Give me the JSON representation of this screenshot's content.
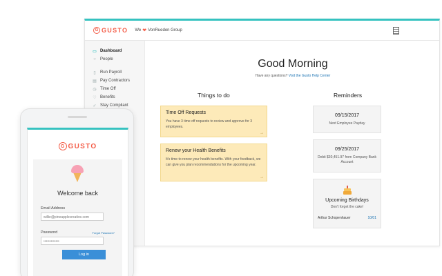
{
  "brand": {
    "logo_text": "GUSTO",
    "accent": "#35c2c0",
    "brand_color": "#f45d48"
  },
  "header": {
    "we_text": "We",
    "company": "VonRueden Group",
    "notes_icon": "document-icon"
  },
  "sidebar": {
    "items": [
      {
        "label": "Dashboard",
        "icon": "folder-icon",
        "active": true
      },
      {
        "label": "People",
        "icon": "person-icon"
      },
      {
        "label": "Run Payroll",
        "icon": "payroll-icon"
      },
      {
        "label": "Pay Contractors",
        "icon": "contractor-icon"
      },
      {
        "label": "Time Off",
        "icon": "clock-icon"
      },
      {
        "label": "Benefits",
        "icon": "heart-icon"
      },
      {
        "label": "Stay Compliant",
        "icon": "check-icon"
      }
    ]
  },
  "main": {
    "greeting": "Good Morning",
    "help_prefix": "Have any questions? ",
    "help_link": "Visit the Gusto Help Center",
    "todo_title": "Things to do",
    "reminders_title": "Reminders",
    "todos": [
      {
        "title": "Time Off Requests",
        "desc": "You have 3 time off requests to review and approve for 3 employees.",
        "arrow": "→"
      },
      {
        "title": "Renew your Health Benefits",
        "desc": "It's time to renew your health benefits. With your feedback, we can give you plan recommendations for the upcoming year.",
        "arrow": "→"
      }
    ],
    "reminders": [
      {
        "date": "09/15/2017",
        "sub": "Next Employee Payday"
      },
      {
        "date": "09/25/2017",
        "sub": "Debit $30,451.97 from Company Bank Account"
      }
    ],
    "birthday": {
      "title": "Upcoming Birthdays",
      "sub": "Don't forget the cake!",
      "name": "Arthur Schopenhauer",
      "date": "10/01"
    }
  },
  "mobile": {
    "welcome": "Welcome back",
    "email_label": "Email Address",
    "email_value": "willie@pineapplecreative.com",
    "password_label": "Password",
    "forgot": "Forgot Password?",
    "password_value": "•••••••••••••",
    "login_button": "Log in"
  }
}
